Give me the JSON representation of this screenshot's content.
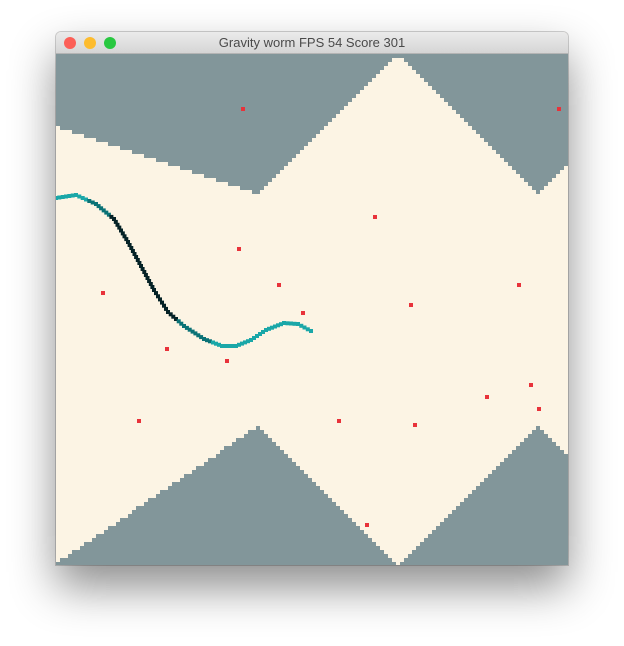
{
  "window": {
    "title": "Gravity worm FPS 54 Score 301"
  },
  "colors": {
    "walls": "#82969a",
    "cavern": "#fcf4e4",
    "food": "#e8323a",
    "worm_head": "#1aa7a8",
    "worm_mid": "#0a7276",
    "worm_dark": "#052226",
    "close_button": "#fc5f57",
    "minimize_button": "#fdbc2e",
    "zoom_button": "#28c840"
  }
}
